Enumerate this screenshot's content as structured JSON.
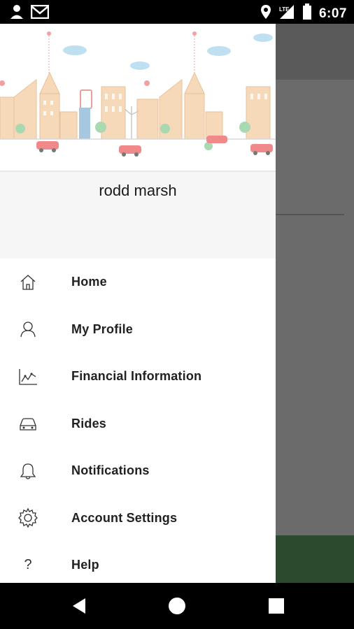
{
  "status_bar": {
    "time": "6:07",
    "network": "LTE"
  },
  "drawer": {
    "user_name": "rodd marsh",
    "menu": [
      {
        "label": "Home",
        "icon": "home-icon"
      },
      {
        "label": "My Profile",
        "icon": "profile-icon"
      },
      {
        "label": "Financial Information",
        "icon": "chart-icon"
      },
      {
        "label": "Rides",
        "icon": "car-icon"
      },
      {
        "label": "Notifications",
        "icon": "bell-icon"
      },
      {
        "label": "Account Settings",
        "icon": "gear-icon"
      },
      {
        "label": "Help",
        "icon": "question-icon"
      }
    ]
  },
  "colors": {
    "scrim": "#6b6b6b",
    "accent_green": "#2c4a2d",
    "text": "#212121"
  }
}
